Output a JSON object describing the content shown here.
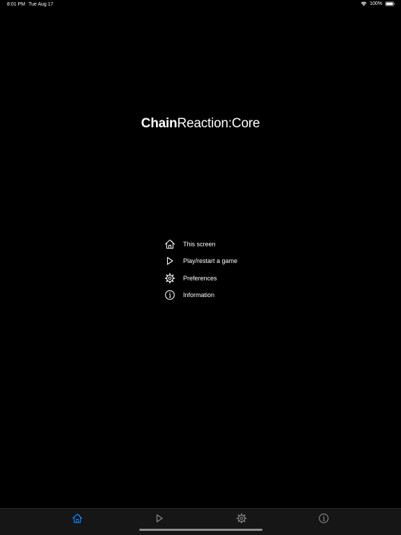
{
  "status_bar": {
    "time": "8:01 PM",
    "date": "Tue Aug 17",
    "battery": "100%"
  },
  "title": {
    "part_bold": "Chain",
    "part_regular": "Reaction:Core"
  },
  "legend": {
    "items": [
      {
        "icon": "house-icon",
        "label": "This screen"
      },
      {
        "icon": "play-icon",
        "label": "Play/restart a game"
      },
      {
        "icon": "gear-icon",
        "label": "Preferences"
      },
      {
        "icon": "info-icon",
        "label": "Information"
      }
    ]
  },
  "tab_bar": {
    "tabs": [
      {
        "icon": "house-icon",
        "selected": true
      },
      {
        "icon": "play-icon",
        "selected": false
      },
      {
        "icon": "gear-icon",
        "selected": false
      },
      {
        "icon": "info-icon",
        "selected": false
      }
    ]
  },
  "colors": {
    "background": "#000000",
    "text": "#ffffff",
    "tab_bar": "#161616",
    "accent": "#0a84ff",
    "tab_inactive": "#8e8e93"
  }
}
